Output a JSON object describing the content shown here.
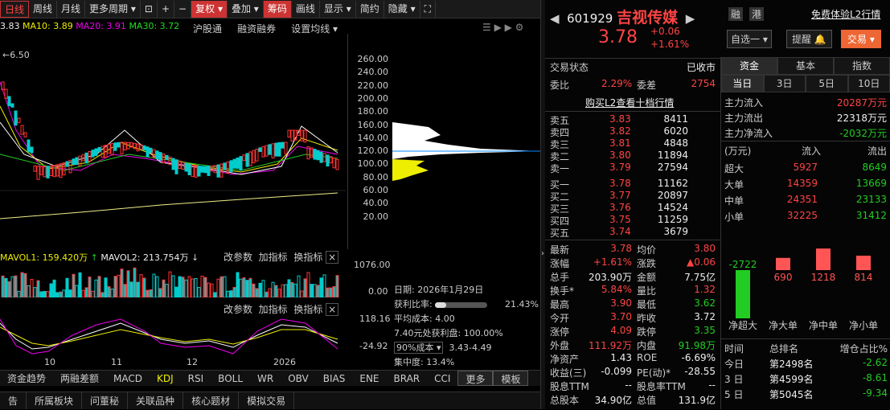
{
  "toolbar": {
    "items": [
      "日线",
      "周线",
      "月线",
      "更多周期",
      "复权",
      "叠加",
      "筹码",
      "画线",
      "显示",
      "简约",
      "隐藏"
    ]
  },
  "ma": {
    "ma5": "3.83",
    "ma10": "MA10: 3.89",
    "ma20": "MA20: 3.91",
    "ma30": "MA30: 3.72",
    "hugutong": "沪股通",
    "rzrq": "融资融券",
    "setma": "设置均线",
    "low_marker": "6.50"
  },
  "price_axis": [
    "260.00",
    "240.00",
    "220.00",
    "200.00",
    "180.00",
    "160.00",
    "140.00",
    "120.00",
    "100.00",
    "80.00",
    "60.00",
    "40.00",
    "20.00"
  ],
  "vol": {
    "mavol1": "MAVOL1: 159.420万",
    "mavol2": "MAVOL2: 213.754万",
    "tools": [
      "改参数",
      "加指标",
      "换指标"
    ],
    "axis_top": "1076.00",
    "axis_bot": "0.00"
  },
  "kdj": {
    "tools": [
      "改参数",
      "加指标",
      "换指标"
    ],
    "axis_top": "118.16",
    "axis_bot": "-24.92"
  },
  "xaxis": [
    "10",
    "11",
    "12",
    "2026"
  ],
  "chips": {
    "date_label": "日期:",
    "date": "2026年1月29日",
    "profit_label": "获利比率:",
    "profit": "21.43%",
    "avg_label": "平均成本:",
    "avg": "4.00",
    "profit_price": "7.40元处获利盘:",
    "profit_price_val": "100.00%",
    "cost_select": "90%成本",
    "cost_range": "3.43-4.49",
    "conc_label": "集中度:",
    "conc": "13.4%"
  },
  "bottom_tabs": [
    "资金趋势",
    "两融差额",
    "MACD",
    "KDJ",
    "RSI",
    "BOLL",
    "WR",
    "OBV",
    "BIAS",
    "ENE",
    "BRAR",
    "CCI",
    "更多",
    "模板"
  ],
  "footer_tabs": [
    "告",
    "所属板块",
    "问董秘",
    "关联品种",
    "核心题材",
    "模拟交易"
  ],
  "stock": {
    "code": "601929",
    "name": "吉视传媒",
    "tag1": "融",
    "tag2": "港",
    "l2": "免费体验L2行情",
    "price": "3.78",
    "chg": "+0.06",
    "pct": "+1.61%",
    "watch": "自选一",
    "remind": "提醒",
    "trade": "交易"
  },
  "status": {
    "label": "交易状态",
    "val": "已收市",
    "weibi_l": "委比",
    "weibi": "2.29%",
    "weicha_l": "委差",
    "weicha": "2754",
    "buyl2": "购买L2查看十档行情"
  },
  "sell": [
    [
      "卖五",
      "3.83",
      "8411"
    ],
    [
      "卖四",
      "3.82",
      "6020"
    ],
    [
      "卖三",
      "3.81",
      "4848"
    ],
    [
      "卖二",
      "3.80",
      "11894"
    ],
    [
      "卖一",
      "3.79",
      "27594"
    ]
  ],
  "buy": [
    [
      "买一",
      "3.78",
      "11162"
    ],
    [
      "买二",
      "3.77",
      "20897"
    ],
    [
      "买三",
      "3.76",
      "14524"
    ],
    [
      "买四",
      "3.75",
      "11259"
    ],
    [
      "买五",
      "3.74",
      "3679"
    ]
  ],
  "quote": [
    [
      "最新",
      "3.78",
      "均价",
      "3.80"
    ],
    [
      "涨幅",
      "+1.61%",
      "涨跌",
      "▲0.06"
    ],
    [
      "总手",
      "203.90万",
      "金额",
      "7.75亿"
    ],
    [
      "换手*",
      "5.84%",
      "量比",
      "1.32"
    ],
    [
      "最高",
      "3.90",
      "最低",
      "3.62"
    ],
    [
      "今开",
      "3.70",
      "昨收",
      "3.72"
    ],
    [
      "涨停",
      "4.09",
      "跌停",
      "3.35"
    ],
    [
      "外盘",
      "111.92万",
      "内盘",
      "91.98万"
    ],
    [
      "净资产",
      "1.43",
      "ROE",
      "-6.69%"
    ],
    [
      "收益(三)",
      "-0.099",
      "PE(动)*",
      "-28.55"
    ],
    [
      "股息TTM",
      "--",
      "股息率TTM",
      "--"
    ],
    [
      "总股本",
      "34.90亿",
      "总值",
      "131.9亿"
    ]
  ],
  "fund": {
    "tabs": [
      "资金",
      "基本",
      "指数"
    ],
    "periods": [
      "当日",
      "3日",
      "5日",
      "10日"
    ],
    "main": [
      [
        "主力流入",
        "20287万元"
      ],
      [
        "主力流出",
        "22318万元"
      ],
      [
        "主力净流入",
        "-2032万元"
      ]
    ],
    "head": [
      "(万元)",
      "流入",
      "流出"
    ],
    "rows": [
      [
        "超大",
        "5927",
        "8649"
      ],
      [
        "大单",
        "14359",
        "13669"
      ],
      [
        "中单",
        "24351",
        "23133"
      ],
      [
        "小单",
        "32225",
        "31412"
      ]
    ],
    "bars": [
      [
        "-2722",
        "净超大"
      ],
      [
        "690",
        "净大单"
      ],
      [
        "1218",
        "净中单"
      ],
      [
        "814",
        "净小单"
      ]
    ],
    "rank_head": [
      "时间",
      "总排名",
      "增仓占比%"
    ],
    "rank": [
      [
        "今日",
        "第2498名",
        "-2.62"
      ],
      [
        "3 日",
        "第4599名",
        "-8.61"
      ],
      [
        "5 日",
        "第5045名",
        "-9.34"
      ]
    ]
  },
  "colors": {
    "up": "#ff4444",
    "down": "#22cc22",
    "bg": "#000000",
    "accent": "#ee0000"
  }
}
